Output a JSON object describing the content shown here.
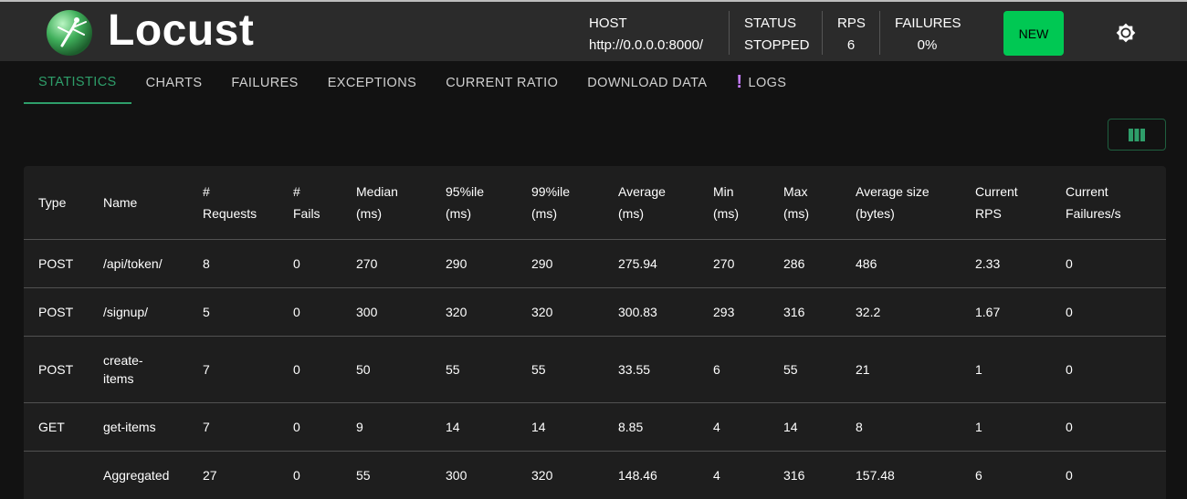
{
  "header": {
    "brand": "Locust",
    "host_label": "HOST",
    "host_value": "http://0.0.0.0:8000/",
    "status_label": "STATUS",
    "status_value": "STOPPED",
    "rps_label": "RPS",
    "rps_value": "6",
    "failures_label": "FAILURES",
    "failures_value": "0%",
    "new_button": "NEW",
    "theme_icon": "sun-icon",
    "accent_color": "#00c853"
  },
  "tabs": [
    {
      "label": "STATISTICS",
      "active": true
    },
    {
      "label": "CHARTS"
    },
    {
      "label": "FAILURES"
    },
    {
      "label": "EXCEPTIONS"
    },
    {
      "label": "CURRENT RATIO"
    },
    {
      "label": "DOWNLOAD DATA"
    },
    {
      "label": "LOGS",
      "icon": "exclamation-icon"
    }
  ],
  "toolbar": {
    "columns_icon": "view-columns-icon"
  },
  "table": {
    "headers": [
      [
        "Type"
      ],
      [
        "Name"
      ],
      [
        "#",
        "Requests"
      ],
      [
        "#",
        "Fails"
      ],
      [
        "Median",
        "(ms)"
      ],
      [
        "95%ile",
        "(ms)"
      ],
      [
        "99%ile",
        "(ms)"
      ],
      [
        "Average",
        "(ms)"
      ],
      [
        "Min",
        "(ms)"
      ],
      [
        "Max",
        "(ms)"
      ],
      [
        "Average size",
        "(bytes)"
      ],
      [
        "Current",
        "RPS"
      ],
      [
        "Current",
        "Failures/s"
      ]
    ],
    "rows": [
      [
        "POST",
        "/api/token/",
        "8",
        "0",
        "270",
        "290",
        "290",
        "275.94",
        "270",
        "286",
        "486",
        "2.33",
        "0"
      ],
      [
        "POST",
        "/signup/",
        "5",
        "0",
        "300",
        "320",
        "320",
        "300.83",
        "293",
        "316",
        "32.2",
        "1.67",
        "0"
      ],
      [
        "POST",
        "create-items",
        "7",
        "0",
        "50",
        "55",
        "55",
        "33.55",
        "6",
        "55",
        "21",
        "1",
        "0"
      ],
      [
        "GET",
        "get-items",
        "7",
        "0",
        "9",
        "14",
        "14",
        "8.85",
        "4",
        "14",
        "8",
        "1",
        "0"
      ],
      [
        "",
        "Aggregated",
        "27",
        "0",
        "55",
        "300",
        "320",
        "148.46",
        "4",
        "316",
        "157.48",
        "6",
        "0"
      ]
    ]
  }
}
